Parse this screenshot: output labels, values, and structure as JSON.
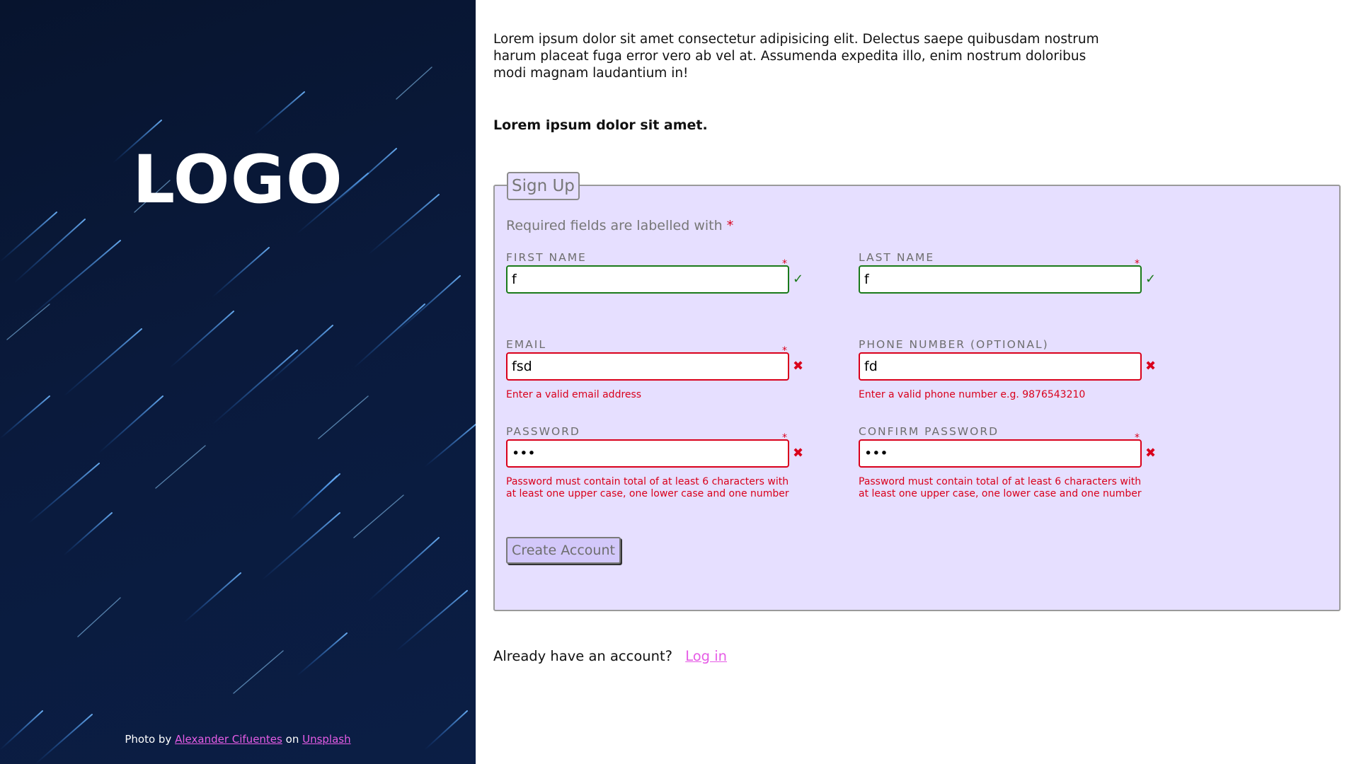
{
  "hero": {
    "logo": "LOGO",
    "credit": {
      "prefix": "Photo by",
      "author": "Alexander Cifuentes",
      "middle": "on",
      "source": "Unsplash"
    }
  },
  "intro": {
    "paragraph": "Lorem ipsum dolor sit amet consectetur adipisicing elit. Delectus saepe quibusdam nostrum harum placeat fuga error vero ab vel at. Assumenda expedita illo, enim nostrum doloribus modi magnam laudantium in!",
    "subheading": "Lorem ipsum dolor sit amet."
  },
  "form": {
    "legend": "Sign Up",
    "required_note": "Required fields are labelled with",
    "required_star": "*",
    "fields": {
      "first_name": {
        "label": "FIRST NAME",
        "value": "f",
        "required": "*",
        "status": "✓"
      },
      "last_name": {
        "label": "LAST NAME",
        "value": "f",
        "required": "*",
        "status": "✓"
      },
      "email": {
        "label": "EMAIL",
        "value": "fsd",
        "required": "*",
        "status": "✖",
        "error": "Enter a valid email address"
      },
      "phone": {
        "label": "PHONE NUMBER (OPTIONAL)",
        "value": "fd",
        "status": "✖",
        "error": "Enter a valid phone number e.g. 9876543210"
      },
      "password": {
        "label": "PASSWORD",
        "value": "abc",
        "required": "*",
        "status": "✖",
        "error": "Password must contain total of at least 6 characters with at least one upper case, one lower case and one number"
      },
      "confirm_password": {
        "label": "CONFIRM PASSWORD",
        "value": "abc",
        "required": "*",
        "status": "✖",
        "error": "Password must contain total of at least 6 characters with at least one upper case, one lower case and one number"
      }
    },
    "submit_label": "Create Account"
  },
  "footer": {
    "prompt": "Already have an account?",
    "login_link": "Log in"
  },
  "colors": {
    "hero_bg": "#0a1a3c",
    "form_bg": "#e6dfff",
    "valid": "#1a7a1a",
    "invalid": "#d9001b",
    "link": "#e65ce6"
  }
}
